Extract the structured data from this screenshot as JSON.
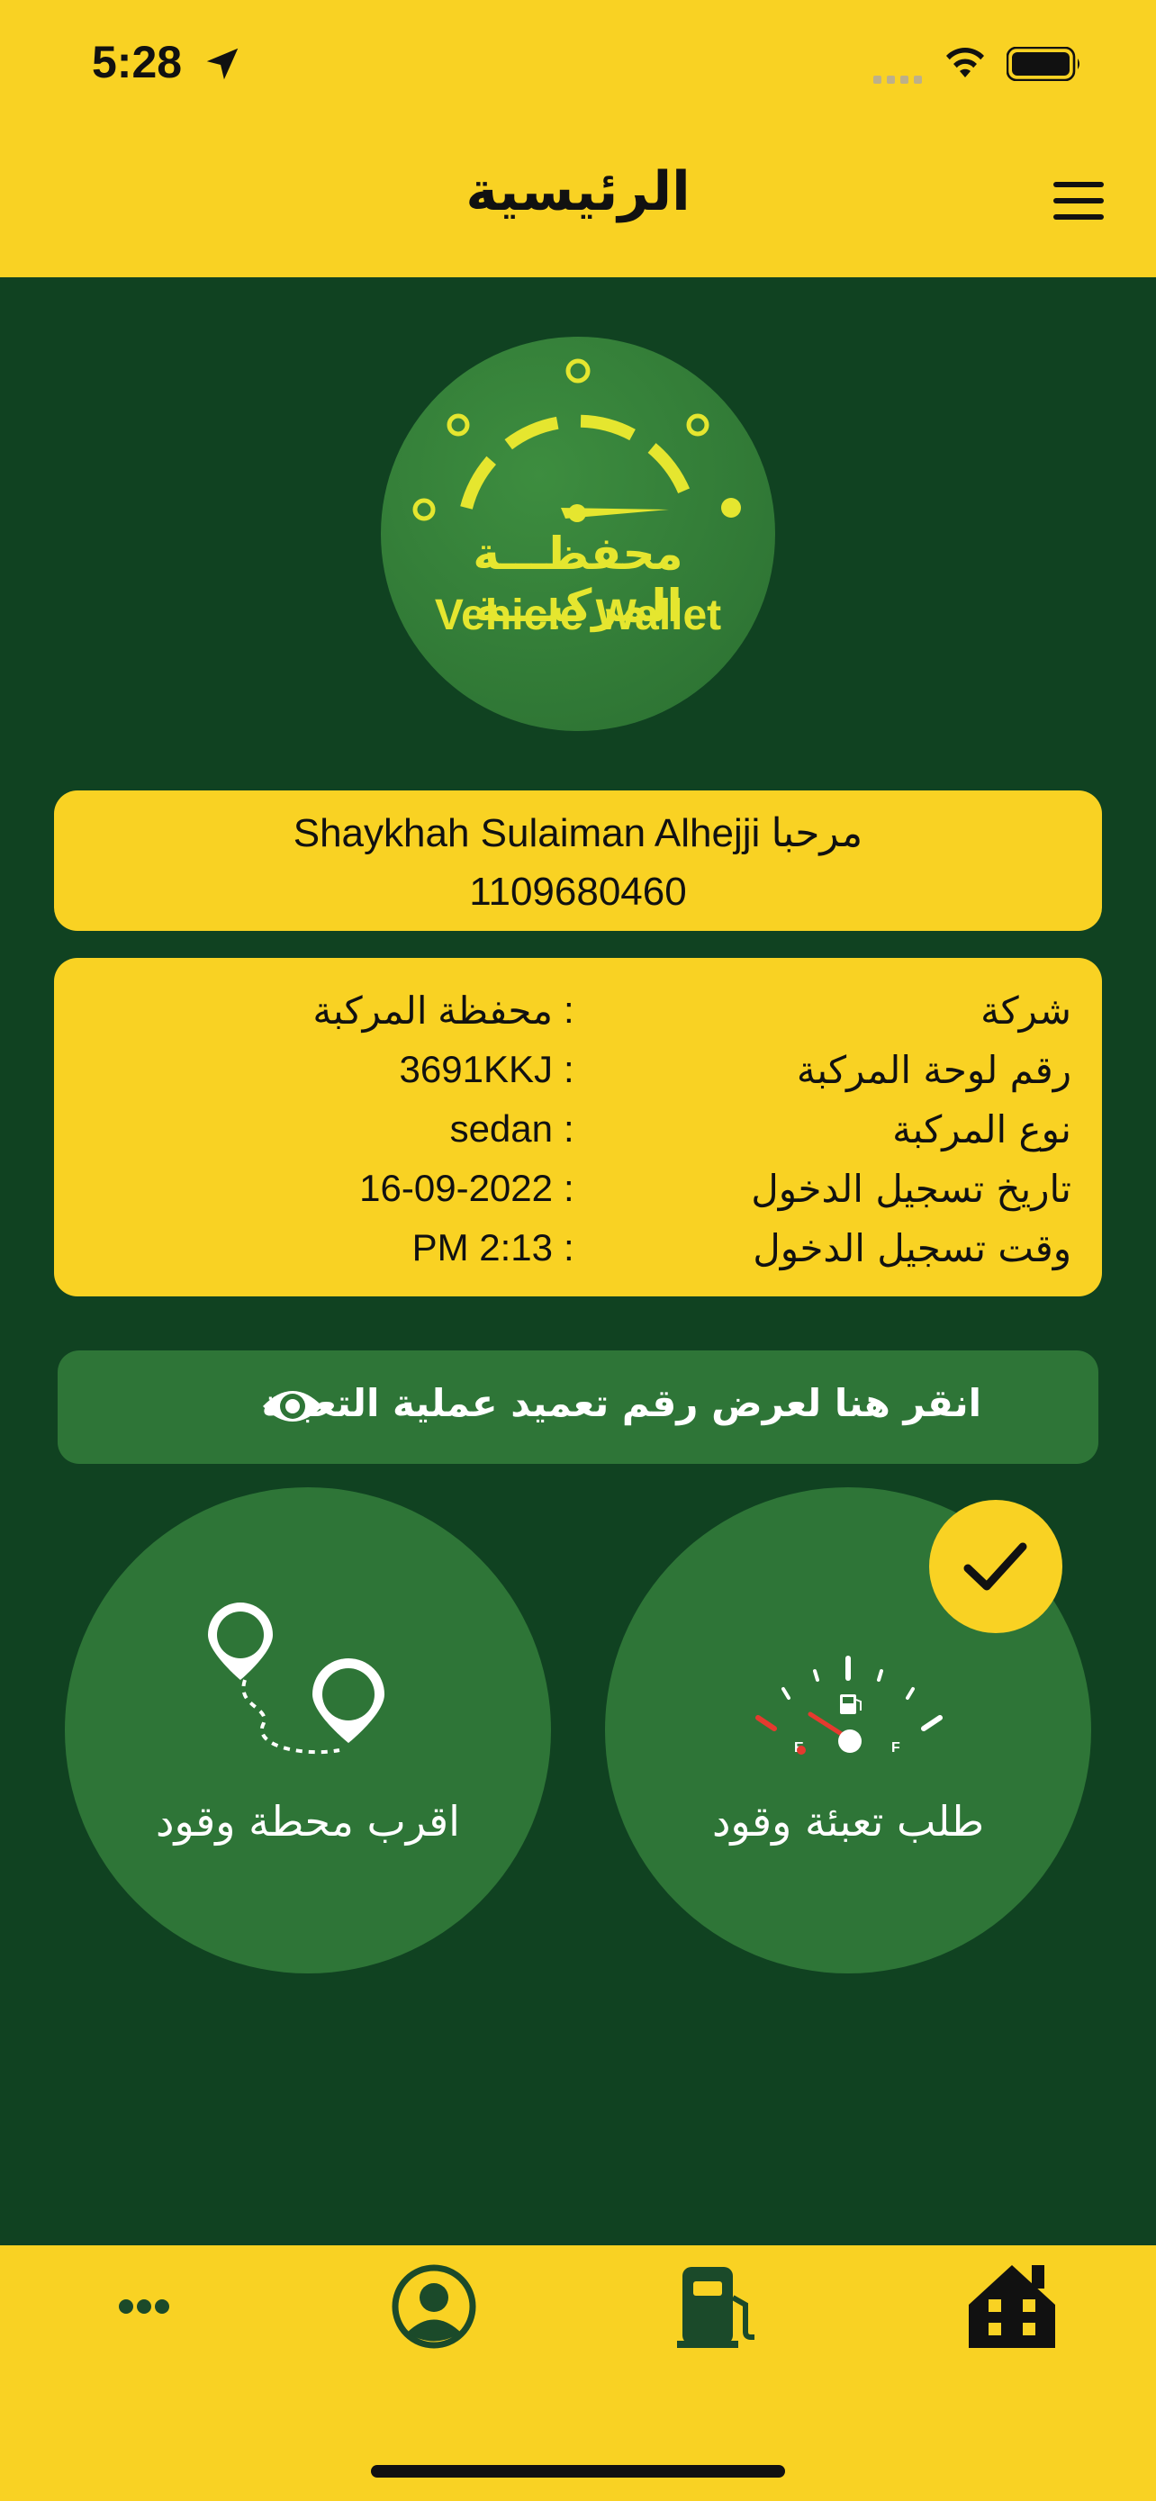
{
  "status_bar": {
    "time": "5:28"
  },
  "header": {
    "title": "الرئيسية"
  },
  "logo": {
    "arabic": "محفظـــة المركبـــة",
    "english": "Vehicle Wallet"
  },
  "welcome": {
    "line1": "Shaykhah Sulaiman Alhejji مرحبا",
    "line2": "1109680460"
  },
  "info": {
    "rows": [
      {
        "label": "شركة",
        "value": "محفظة المركبة"
      },
      {
        "label": "رقم لوحة المركبة",
        "value": "3691KKJ"
      },
      {
        "label": "نوع المركبة",
        "value": "sedan"
      },
      {
        "label": "تاريخ تسجيل الدخول",
        "value": "16-09-2022"
      },
      {
        "label": "وقت تسجيل الدخول",
        "value": "PM 2:13"
      }
    ],
    "separator": ":"
  },
  "approval_button": {
    "label": "انقر هنا لعرض رقم تعميد عملية التعبئة"
  },
  "actions": {
    "nearest_station": "اقرب محطة وقود",
    "refuel_request": "طلب تعبئة وقود",
    "gauge_empty": "E",
    "gauge_full": "F"
  },
  "bottom_nav": {
    "items": [
      "more-icon",
      "profile-icon",
      "fuel-pump-icon",
      "home-icon"
    ]
  },
  "colors": {
    "yellow": "#F9D223",
    "dark_green": "#104221",
    "green": "#2E7537",
    "logo_text": "#e5e62f"
  }
}
